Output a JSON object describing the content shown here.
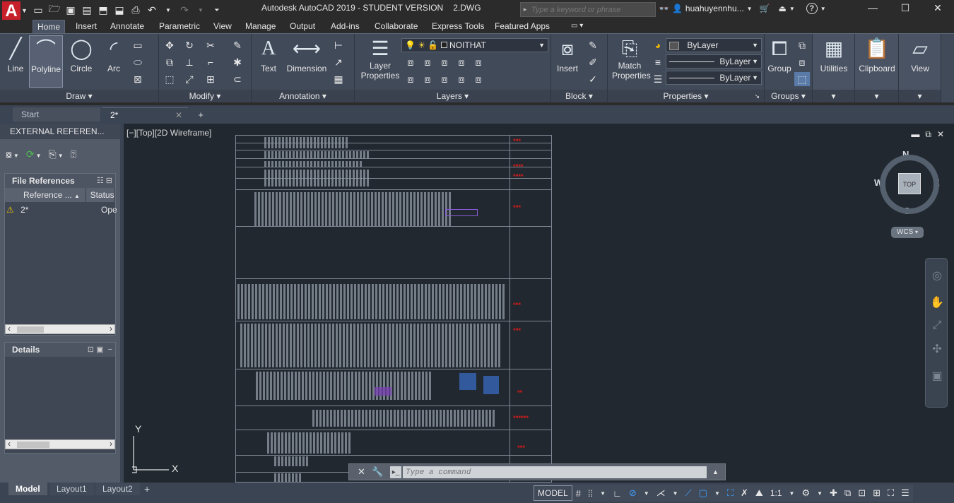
{
  "title_bar": {
    "app_title": "Autodesk AutoCAD 2019 - STUDENT VERSION",
    "file_name": "2.DWG",
    "search_placeholder": "Type a keyword or phrase",
    "user_name": "huahuyennhu...",
    "quick_access_icons": [
      "new-icon",
      "open-icon",
      "save-icon",
      "save-as-icon",
      "web-open-icon",
      "web-save-icon",
      "plot-icon",
      "undo-icon",
      "redo-icon",
      "customize-dropdown-icon"
    ],
    "right_icons": [
      "binoculars-icon",
      "user-icon",
      "cart-icon",
      "a360-icon",
      "help-icon"
    ]
  },
  "ribbon_tabs": [
    "Home",
    "Insert",
    "Annotate",
    "Parametric",
    "View",
    "Manage",
    "Output",
    "Add-ins",
    "Collaborate",
    "Express Tools",
    "Featured Apps"
  ],
  "active_ribbon_tab": "Home",
  "ribbon": {
    "draw": {
      "title": "Draw",
      "line": "Line",
      "polyline": "Polyline",
      "circle": "Circle",
      "arc": "Arc"
    },
    "modify": {
      "title": "Modify"
    },
    "annotation": {
      "title": "Annotation",
      "text": "Text",
      "dimension": "Dimension"
    },
    "layers": {
      "title": "Layers",
      "layer_properties_1": "Layer",
      "layer_properties_2": "Properties",
      "current_layer": "NOITHAT"
    },
    "block": {
      "title": "Block",
      "insert": "Insert"
    },
    "properties": {
      "title": "Properties",
      "match_1": "Match",
      "match_2": "Properties",
      "color": "ByLayer",
      "linetype": "ByLayer",
      "lineweight": "ByLayer"
    },
    "groups": {
      "title": "Groups",
      "group": "Group"
    },
    "utilities": "Utilities",
    "clipboard": "Clipboard",
    "view": "View"
  },
  "file_tabs": [
    {
      "label": "Start"
    },
    {
      "label": "2*"
    }
  ],
  "xref_palette": {
    "title": "EXTERNAL REFEREN...",
    "file_references": "File References",
    "col_reference": "Reference ...",
    "col_status": "Status",
    "rows": [
      {
        "name": "2*",
        "status": "Ope"
      }
    ],
    "details": "Details"
  },
  "viewport": {
    "label": "[−][Top][2D Wireframe]",
    "viewcube_top": "TOP",
    "compass": {
      "n": "N",
      "s": "S",
      "e": "E",
      "w": "W"
    },
    "wcs": "WCS",
    "ucs_x": "X",
    "ucs_y": "Y"
  },
  "command_line": {
    "placeholder": "Type a command"
  },
  "layout_tabs": [
    "Model",
    "Layout1",
    "Layout2"
  ],
  "active_layout": "Model",
  "status_bar": {
    "model": "MODEL",
    "scale": "1:1"
  },
  "colors": {
    "app_red": "#c8202b",
    "ribbon_bg": "#414a59",
    "canvas_bg": "#212830",
    "active_blue": "#3fa2ff"
  }
}
